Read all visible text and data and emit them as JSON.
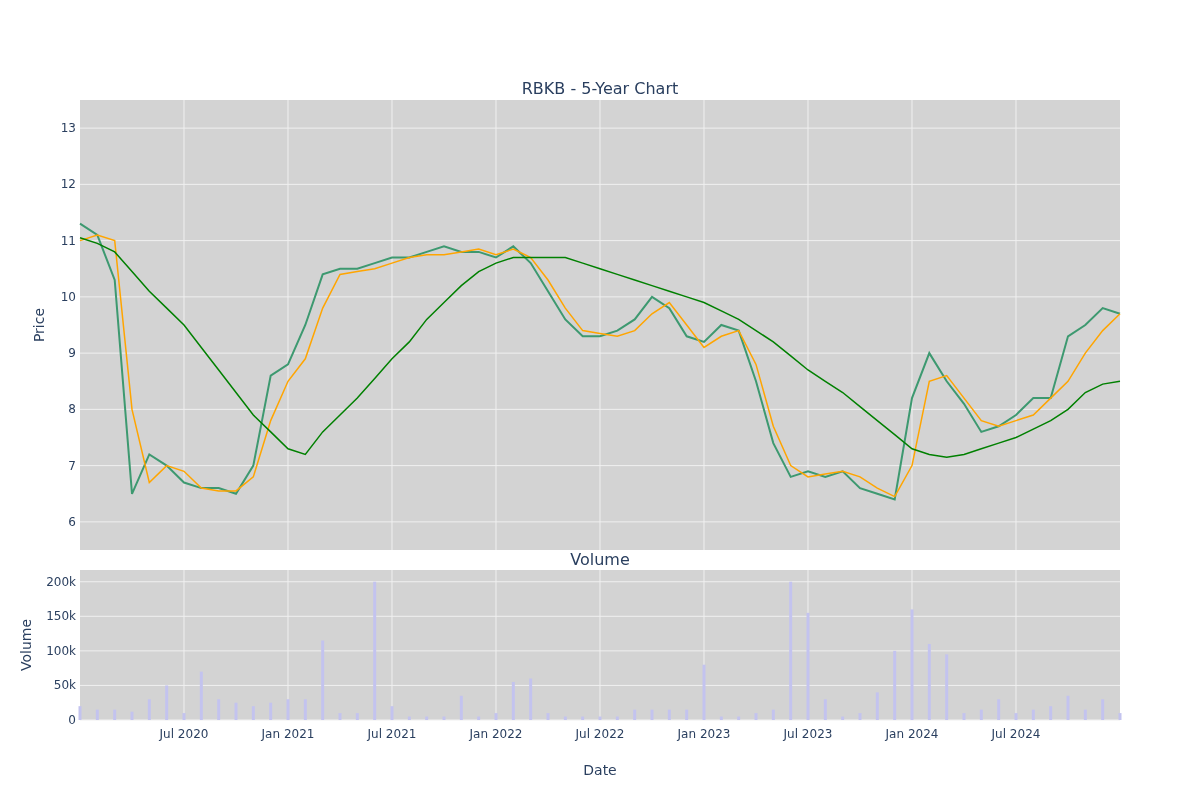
{
  "price_chart": {
    "chart_data": {
      "type": "line",
      "title": "RBKB - 5-Year Chart",
      "ylabel": "Price",
      "categories": [
        null,
        null,
        null,
        null,
        null,
        null,
        null,
        null,
        null,
        null,
        null,
        null,
        null,
        null,
        null,
        null,
        null,
        null,
        null,
        null,
        null,
        null,
        null,
        null,
        null,
        null,
        null,
        null,
        null,
        null,
        null,
        null,
        null,
        null,
        null,
        null,
        null,
        null,
        null,
        null,
        null,
        null,
        null,
        null,
        null,
        null,
        null,
        null,
        null,
        null,
        null,
        null,
        null,
        null,
        null,
        null,
        null,
        null,
        null,
        null,
        null
      ],
      "ylim": [
        5.5,
        13.5
      ],
      "grid": true,
      "yticks": [
        6,
        7,
        8,
        9,
        10,
        11,
        12,
        13
      ],
      "series": [
        {
          "color": "#3d9970",
          "values": [
            11.3,
            11.1,
            10.3,
            6.5,
            7.2,
            7.0,
            6.7,
            6.6,
            6.6,
            6.5,
            7.0,
            8.6,
            8.8,
            9.5,
            10.4,
            10.5,
            10.5,
            10.6,
            10.7,
            10.7,
            10.8,
            10.9,
            10.8,
            10.8,
            10.7,
            10.9,
            10.6,
            10.1,
            9.6,
            9.3,
            9.3,
            9.4,
            9.6,
            10.0,
            9.8,
            9.3,
            9.2,
            9.5,
            9.4,
            8.5,
            7.4,
            6.8,
            6.9,
            6.8,
            6.9,
            6.6,
            6.5,
            6.4,
            8.2,
            9.0,
            8.5,
            8.1,
            7.6,
            7.7,
            7.9,
            8.2,
            8.2,
            9.3,
            9.5,
            9.8,
            9.7
          ]
        },
        {
          "color": "#ffa500",
          "values": [
            11.0,
            11.1,
            11.0,
            8.0,
            6.7,
            7.0,
            6.9,
            6.6,
            6.55,
            6.55,
            6.8,
            7.8,
            8.5,
            8.9,
            9.8,
            10.4,
            10.45,
            10.5,
            10.6,
            10.7,
            10.75,
            10.75,
            10.8,
            10.85,
            10.75,
            10.85,
            10.7,
            10.3,
            9.8,
            9.4,
            9.35,
            9.3,
            9.4,
            9.7,
            9.9,
            9.5,
            9.1,
            9.3,
            9.4,
            8.8,
            7.7,
            7.0,
            6.8,
            6.85,
            6.9,
            6.8,
            6.6,
            6.45,
            7.0,
            8.5,
            8.6,
            8.2,
            7.8,
            7.7,
            7.8,
            7.9,
            8.2,
            8.5,
            9.0,
            9.4,
            9.7
          ]
        },
        {
          "color": "#008000",
          "values": [
            11.05,
            10.95,
            10.8,
            10.45,
            10.1,
            9.8,
            9.5,
            9.1,
            8.7,
            8.3,
            7.9,
            7.6,
            7.3,
            7.2,
            7.6,
            7.9,
            8.2,
            8.55,
            8.9,
            9.2,
            9.6,
            9.9,
            10.2,
            10.45,
            10.6,
            10.7,
            10.7,
            10.7,
            10.7,
            10.6,
            10.5,
            10.4,
            10.3,
            10.2,
            10.1,
            10.0,
            9.9,
            9.75,
            9.6,
            9.4,
            9.2,
            8.95,
            8.7,
            8.5,
            8.3,
            8.05,
            7.8,
            7.55,
            7.3,
            7.2,
            7.15,
            7.2,
            7.3,
            7.4,
            7.5,
            7.65,
            7.8,
            8.0,
            8.3,
            8.45,
            8.5
          ]
        }
      ]
    }
  },
  "volume_chart": {
    "chart_data": {
      "type": "bar",
      "title": "Volume",
      "xlabel": "Date",
      "ylabel": "Volume",
      "categories": [
        null,
        null,
        null,
        null,
        null,
        null,
        "Jul 2020",
        null,
        null,
        null,
        null,
        null,
        "Jan 2021",
        null,
        null,
        null,
        null,
        null,
        "Jul 2021",
        null,
        null,
        null,
        null,
        null,
        "Jan 2022",
        null,
        null,
        null,
        null,
        null,
        "Jul 2022",
        null,
        null,
        null,
        null,
        null,
        "Jan 2023",
        null,
        null,
        null,
        null,
        null,
        "Jul 2023",
        null,
        null,
        null,
        null,
        null,
        "Jan 2024",
        null,
        null,
        null,
        null,
        null,
        "Jul 2024",
        null,
        null,
        null,
        null,
        null,
        null
      ],
      "ylim": [
        0,
        217000
      ],
      "grid": true,
      "yticks": [
        {
          "value": 0,
          "label": "0"
        },
        {
          "value": 50000,
          "label": "50k"
        },
        {
          "value": 100000,
          "label": "100k"
        },
        {
          "value": 150000,
          "label": "150k"
        },
        {
          "value": 200000,
          "label": "200k"
        }
      ],
      "series": [
        {
          "color": "#c3c3ef",
          "values": [
            20000,
            15000,
            15000,
            12000,
            30000,
            50000,
            10000,
            70000,
            30000,
            25000,
            20000,
            25000,
            30000,
            30000,
            115000,
            10000,
            10000,
            200000,
            20000,
            5000,
            5000,
            5000,
            35000,
            5000,
            10000,
            55000,
            60000,
            10000,
            5000,
            5000,
            5000,
            5000,
            15000,
            15000,
            15000,
            15000,
            80000,
            5000,
            5000,
            10000,
            15000,
            200000,
            155000,
            30000,
            5000,
            10000,
            40000,
            100000,
            160000,
            110000,
            95000,
            10000,
            15000,
            30000,
            10000,
            15000,
            20000,
            35000,
            15000,
            30000,
            10000
          ]
        }
      ]
    }
  }
}
